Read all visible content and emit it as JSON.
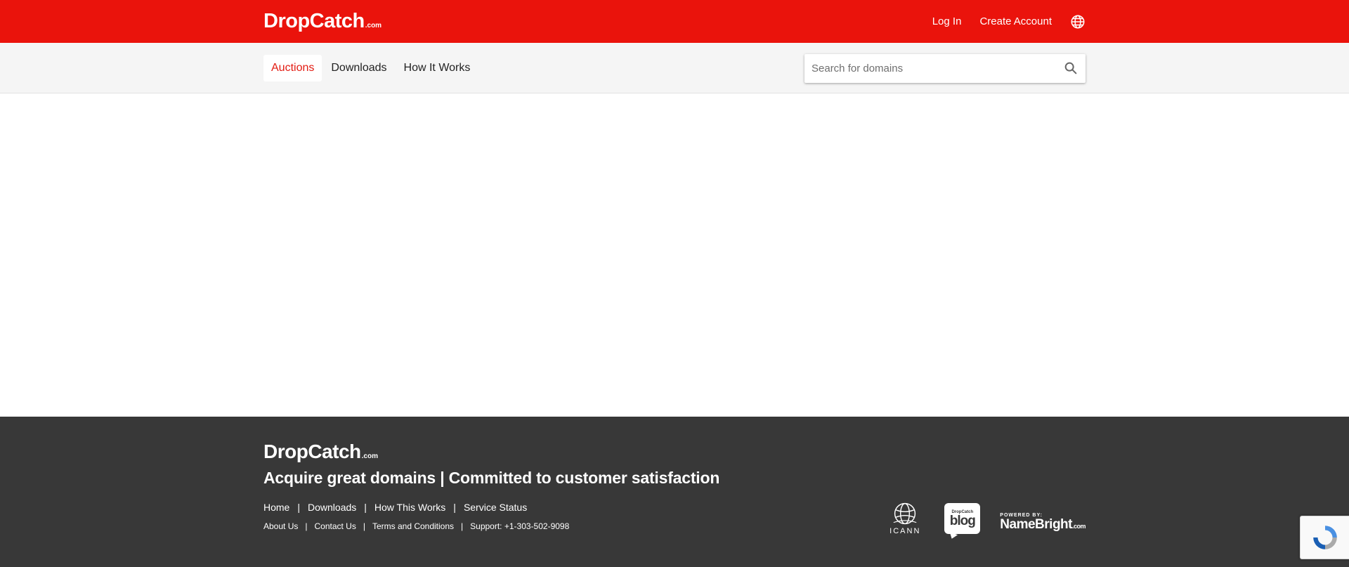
{
  "brand": {
    "name": "DropCatch",
    "suffix": ".com",
    "primary_color": "#ea130c"
  },
  "header": {
    "login_label": "Log In",
    "create_account_label": "Create Account",
    "language_icon": "globe-icon"
  },
  "nav": {
    "tabs": [
      {
        "label": "Auctions",
        "active": true
      },
      {
        "label": "Downloads",
        "active": false
      },
      {
        "label": "How It Works",
        "active": false
      }
    ],
    "search": {
      "placeholder": "Search for domains",
      "value": "",
      "icon": "search-icon"
    }
  },
  "footer": {
    "tagline": "Acquire great domains | Committed to customer satisfaction",
    "primary_links": [
      "Home",
      "Downloads",
      "How This Works",
      "Service Status"
    ],
    "secondary_links": [
      "About Us",
      "Contact Us",
      "Terms and Conditions"
    ],
    "support_text": "Support: +1-303-502-9098",
    "partners": {
      "icann_label": "ICANN",
      "blog_small": "DropCatch",
      "blog_big": "blog",
      "powered_by": "POWERED BY:",
      "namebright": "NameBright",
      "namebright_suffix": ".com"
    },
    "background_color": "#383838"
  }
}
